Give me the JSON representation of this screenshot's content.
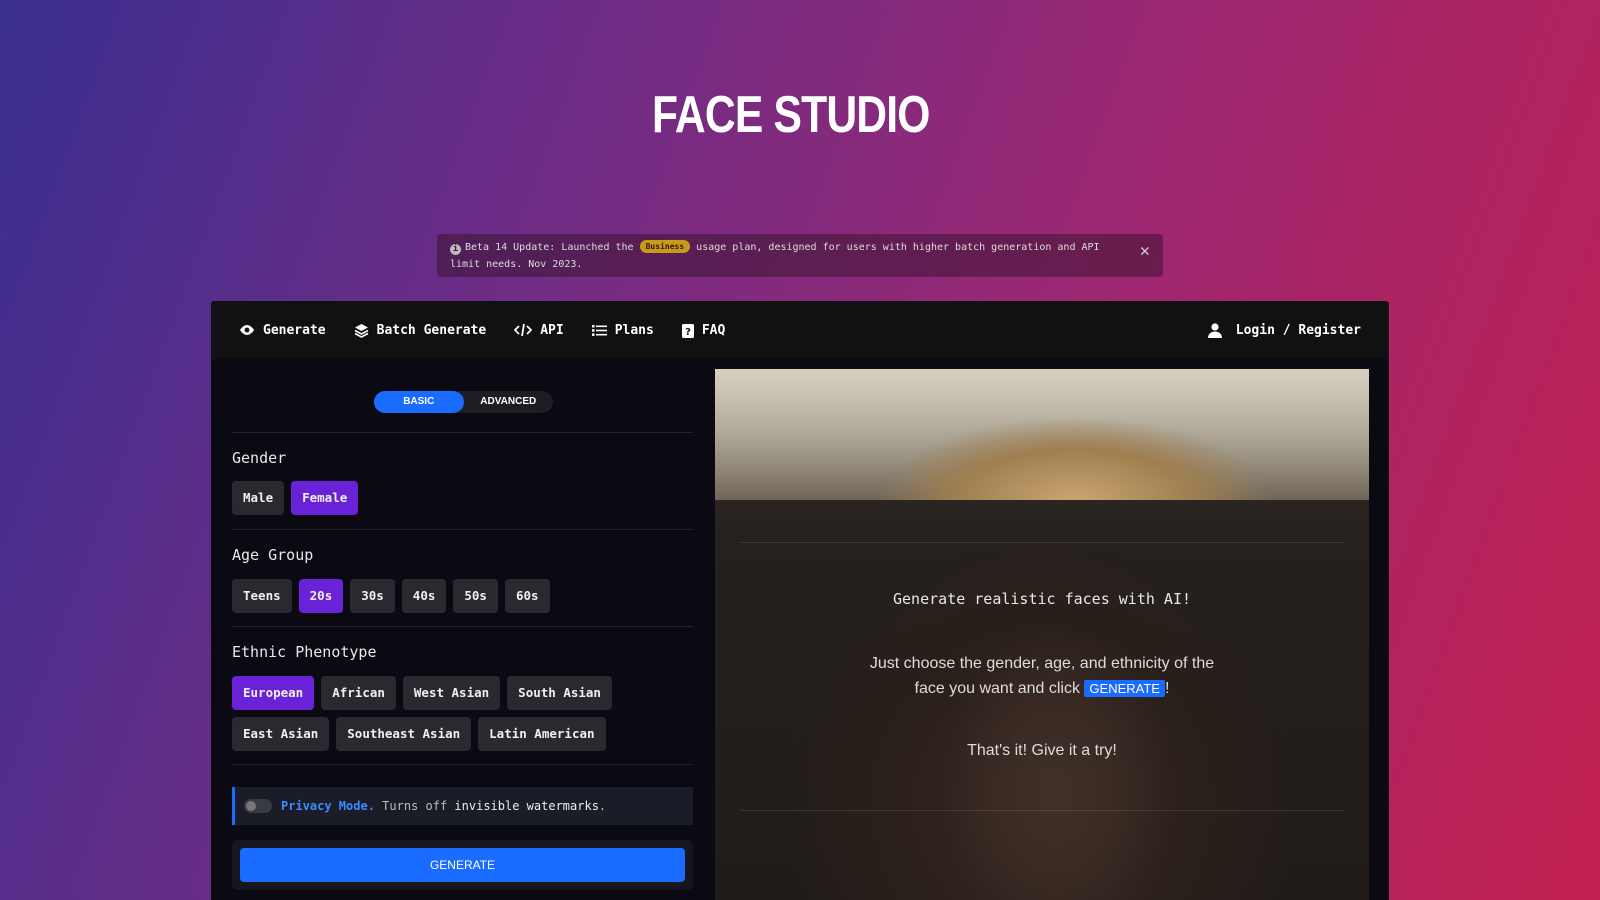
{
  "brand": {
    "name": "FACE STUDIO"
  },
  "notice": {
    "text_before": "Beta 14 Update: Launched the",
    "badge": "Business",
    "text_after": "usage plan, designed for users with higher batch generation and API limit needs. Nov 2023."
  },
  "nav": {
    "items": [
      {
        "label": "Generate",
        "icon": "eye-icon"
      },
      {
        "label": "Batch Generate",
        "icon": "layers-icon"
      },
      {
        "label": "API",
        "icon": "code-icon"
      },
      {
        "label": "Plans",
        "icon": "list-icon"
      },
      {
        "label": "FAQ",
        "icon": "question-icon"
      }
    ],
    "login": "Login / Register"
  },
  "mode_toggle": {
    "basic": "BASIC",
    "advanced": "ADVANCED",
    "selected": "BASIC"
  },
  "gender": {
    "title": "Gender",
    "options": [
      "Male",
      "Female"
    ],
    "selected": "Female"
  },
  "age_group": {
    "title": "Age Group",
    "options": [
      "Teens",
      "20s",
      "30s",
      "40s",
      "50s",
      "60s"
    ],
    "selected": "20s"
  },
  "ethnic": {
    "title": "Ethnic Phenotype",
    "options": [
      "European",
      "African",
      "West Asian",
      "South Asian",
      "East Asian",
      "Southeast Asian",
      "Latin American"
    ],
    "selected": "European"
  },
  "privacy": {
    "label": "Privacy Mode.",
    "text1": "Turns off",
    "text2": "invisible watermarks",
    "text3": ".",
    "enabled": false
  },
  "generate_button": "GENERATE",
  "preview": {
    "title": "Generate realistic faces with AI!",
    "desc_before": "Just choose the gender, age, and ethnicity of the face you want and click",
    "desc_button": "GENERATE",
    "desc_after": "!",
    "try": "That's it! Give it a try!"
  },
  "colors": {
    "accent_blue": "#1a6bff",
    "selected_purple": "#6a22d8",
    "badge_gold": "#c89a1a"
  }
}
